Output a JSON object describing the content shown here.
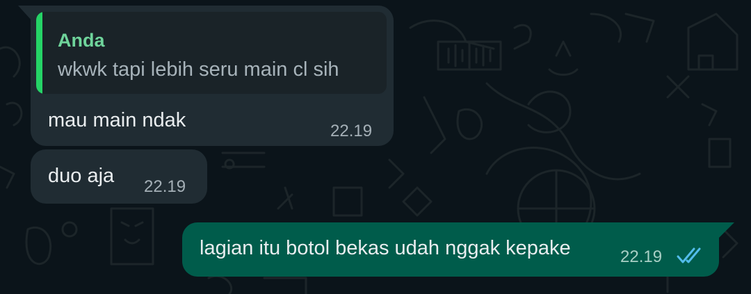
{
  "theme": {
    "background": "#0b141a",
    "incoming_bubble": "#202c33",
    "outgoing_bubble": "#005c4b",
    "quote_accent": "#25d366",
    "read_ticks": "#53bdeb"
  },
  "messages": [
    {
      "direction": "incoming",
      "reply_to": {
        "author": "Anda",
        "text": "wkwk tapi lebih seru main cl sih"
      },
      "text": "mau main ndak",
      "time": "22.19"
    },
    {
      "direction": "incoming",
      "text": "duo aja",
      "time": "22.19"
    },
    {
      "direction": "outgoing",
      "text": "lagian itu botol bekas udah nggak kepake",
      "time": "22.19",
      "status_icon": "double-check-read-icon"
    }
  ]
}
